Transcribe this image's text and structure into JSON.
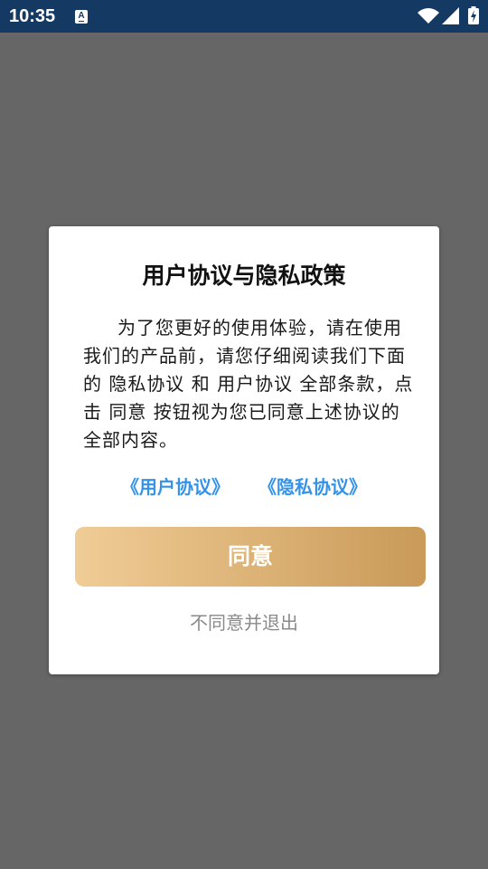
{
  "status_bar": {
    "time": "10:35",
    "a_icon_glyph": "A",
    "icons": [
      "notification-a-icon",
      "wifi-icon",
      "cellular-signal-icon",
      "battery-charging-icon"
    ],
    "background_color": "#143a64",
    "icon_color": "#ffffff"
  },
  "overlay_color": "#666666",
  "dialog": {
    "title": "用户协议与隐私政策",
    "body_lines": [
      "为了您更好的使用体验，请在使用",
      "我们的产品前，请您仔细阅读我们下面",
      "的 隐私协议 和 用户协议 全部条款，点",
      "击 同意 按钮视为您已同意上述协议的",
      "全部内容。"
    ],
    "links": {
      "user_agreement": "《用户协议》",
      "privacy_agreement": "《隐私协议》",
      "color": "#3392ea"
    },
    "agree_button": {
      "label": "同意",
      "gradient_start": "#f0cc96",
      "gradient_end": "#c99a58"
    },
    "disagree_link": "不同意并退出"
  }
}
